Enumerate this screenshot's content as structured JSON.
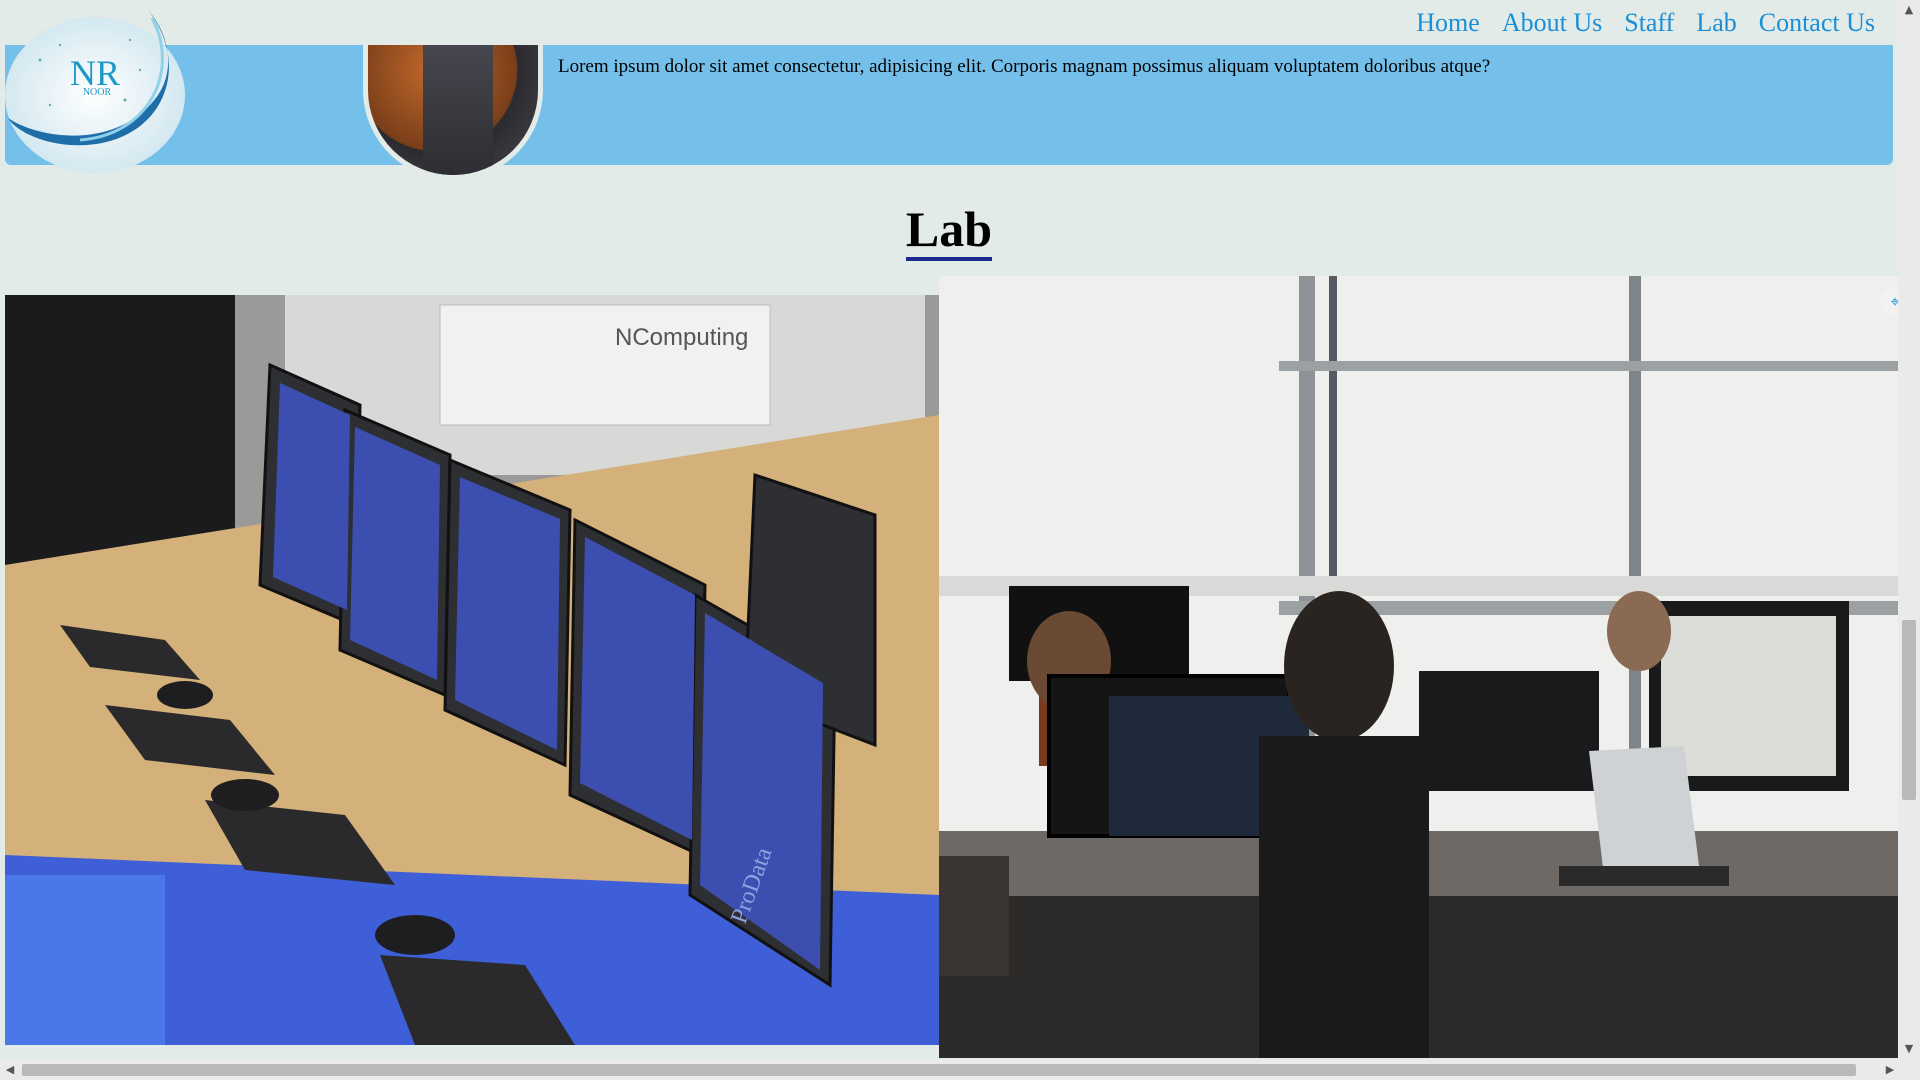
{
  "logo": {
    "text": "NR",
    "subtext": "NOOR"
  },
  "nav": {
    "items": [
      {
        "label": "Home"
      },
      {
        "label": "About Us"
      },
      {
        "label": "Staff"
      },
      {
        "label": "Lab"
      },
      {
        "label": "Contact Us"
      }
    ]
  },
  "banner": {
    "text": "Lorem ipsum dolor sit amet consectetur, adipisicing elit. Corporis magnam possimus aliquam voluptatem doloribus atque?"
  },
  "section": {
    "title": "Lab"
  },
  "photos": {
    "left_brand": "NComputing",
    "monitor_brand": "ProData"
  },
  "colors": {
    "background": "#e2ebe7",
    "banner": "#75c0ea",
    "nav_link": "#1a8fd8",
    "title_underline": "#1a2a8a"
  }
}
